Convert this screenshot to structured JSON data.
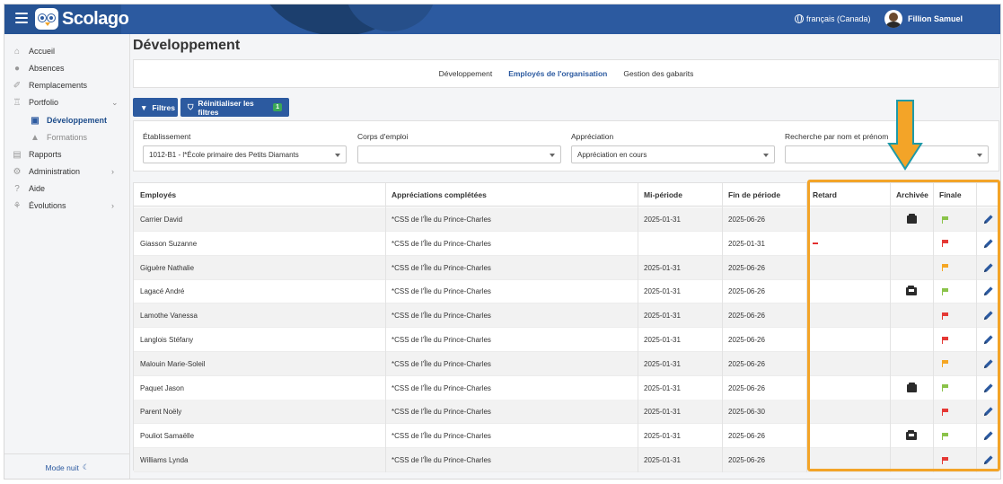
{
  "colors": {
    "brand": "#2c5aa0",
    "accent": "#f3a428",
    "flag_green": "#8bc34a",
    "flag_red": "#e53935",
    "flag_orange": "#f5a623"
  },
  "header": {
    "menu_icon": "hamburger-icon",
    "logo_text": "Scolago",
    "language": "français (Canada)",
    "user_name": "Fillion Samuel"
  },
  "sidebar": {
    "items": [
      {
        "label": "Accueil",
        "icon": "home-icon"
      },
      {
        "label": "Absences",
        "icon": "absence-icon"
      },
      {
        "label": "Remplacements",
        "icon": "replacement-icon"
      },
      {
        "label": "Portfolio",
        "icon": "trophy-icon"
      },
      {
        "label": "Développement",
        "icon": "development-icon"
      },
      {
        "label": "Formations",
        "icon": "graduation-cap-icon"
      },
      {
        "label": "Rapports",
        "icon": "report-icon"
      },
      {
        "label": "Administration",
        "icon": "gear-icon"
      },
      {
        "label": "Aide",
        "icon": "help-icon"
      },
      {
        "label": "Évolutions",
        "icon": "evolution-icon"
      }
    ],
    "night_mode": "Mode nuit"
  },
  "page": {
    "title": "Développement"
  },
  "tabs": [
    "Développement",
    "Employés de l'organisation",
    "Gestion des gabarits"
  ],
  "toolbar": {
    "filters": "Filtres",
    "reset_filters": "Réinitialiser les filtres",
    "reset_badge": "1"
  },
  "filters": {
    "etablissement": {
      "label": "Établissement",
      "value": "1012-B1 - l*École primaire des Petits Diamants"
    },
    "corps_emploi": {
      "label": "Corps d'emploi",
      "value": ""
    },
    "appreciation": {
      "label": "Appréciation",
      "value": "Appréciation en cours"
    },
    "recherche": {
      "label": "Recherche par nom et prénom",
      "value": ""
    }
  },
  "table": {
    "columns": [
      "Employés",
      "Appréciations complétées",
      "Mi-période",
      "Fin de période",
      "Retard",
      "Archivée",
      "Finale"
    ],
    "rows": [
      {
        "employe": "Carrier David",
        "appreciations": "*CSS de l'Île du Prince-Charles",
        "mi_periode": "2025-01-31",
        "fin_periode": "2025-06-26",
        "retard": "",
        "archivee": "archive-closed",
        "finale": "green"
      },
      {
        "employe": "Giasson Suzanne",
        "appreciations": "*CSS de l'Île du Prince-Charles",
        "mi_periode": "",
        "fin_periode": "2025-01-31",
        "retard": "late",
        "archivee": "",
        "finale": "red"
      },
      {
        "employe": "Giguère Nathalie",
        "appreciations": "*CSS de l'Île du Prince-Charles",
        "mi_periode": "2025-01-31",
        "fin_periode": "2025-06-26",
        "retard": "",
        "archivee": "",
        "finale": "orange"
      },
      {
        "employe": "Lagacé André",
        "appreciations": "*CSS de l'Île du Prince-Charles",
        "mi_periode": "2025-01-31",
        "fin_periode": "2025-06-26",
        "retard": "",
        "archivee": "archive-open",
        "finale": "green"
      },
      {
        "employe": "Lamothe Vanessa",
        "appreciations": "*CSS de l'Île du Prince-Charles",
        "mi_periode": "2025-01-31",
        "fin_periode": "2025-06-26",
        "retard": "",
        "archivee": "",
        "finale": "red"
      },
      {
        "employe": "Langlois Stéfany",
        "appreciations": "*CSS de l'Île du Prince-Charles",
        "mi_periode": "2025-01-31",
        "fin_periode": "2025-06-26",
        "retard": "",
        "archivee": "",
        "finale": "red"
      },
      {
        "employe": "Malouin Marie-Soleil",
        "appreciations": "*CSS de l'Île du Prince-Charles",
        "mi_periode": "2025-01-31",
        "fin_periode": "2025-06-26",
        "retard": "",
        "archivee": "",
        "finale": "orange"
      },
      {
        "employe": "Paquet Jason",
        "appreciations": "*CSS de l'Île du Prince-Charles",
        "mi_periode": "2025-01-31",
        "fin_periode": "2025-06-26",
        "retard": "",
        "archivee": "archive-closed",
        "finale": "green"
      },
      {
        "employe": "Parent Noëly",
        "appreciations": "*CSS de l'Île du Prince-Charles",
        "mi_periode": "2025-01-31",
        "fin_periode": "2025-06-30",
        "retard": "",
        "archivee": "",
        "finale": "red"
      },
      {
        "employe": "Pouliot Samaëlle",
        "appreciations": "*CSS de l'Île du Prince-Charles",
        "mi_periode": "2025-01-31",
        "fin_periode": "2025-06-26",
        "retard": "",
        "archivee": "archive-open",
        "finale": "green"
      },
      {
        "employe": "Williams Lynda",
        "appreciations": "*CSS de l'Île du Prince-Charles",
        "mi_periode": "2025-01-31",
        "fin_periode": "2025-06-26",
        "retard": "",
        "archivee": "",
        "finale": "red"
      }
    ]
  }
}
